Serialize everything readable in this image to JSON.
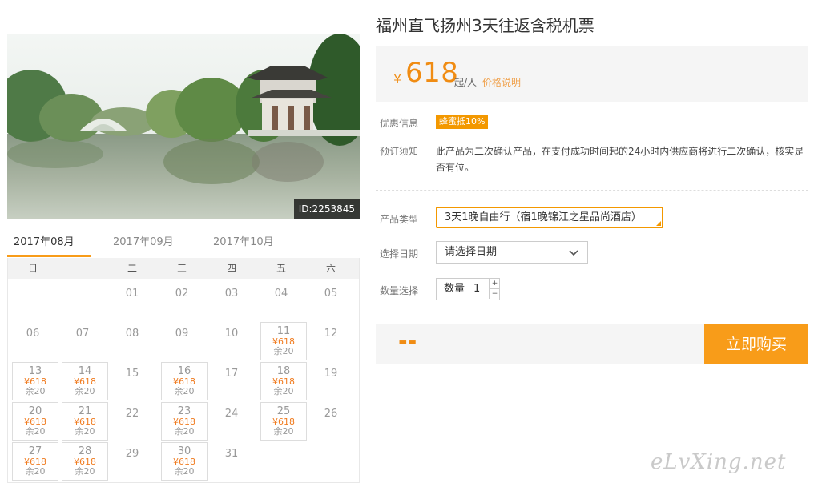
{
  "product": {
    "title": "福州直飞扬州3天往返含税机票",
    "image_id": "ID:2253845"
  },
  "price": {
    "currency": "¥",
    "amount": "618",
    "unit": "起/人",
    "note_link": "价格说明"
  },
  "promo": {
    "label": "优惠信息",
    "tag": "蜂蜜抵10%"
  },
  "notice": {
    "label": "预订须知",
    "text": "此产品为二次确认产品，在支付成功时间起的24小时内供应商将进行二次确认，核实是否有位。"
  },
  "options": {
    "type_label": "产品类型",
    "type_value": "3天1晚自由行（宿1晚锦江之星品尚酒店）",
    "date_label": "选择日期",
    "date_placeholder": "请选择日期",
    "qty_section_label": "数量选择",
    "qty_label": "数量",
    "qty_value": "1",
    "qty_up": "+",
    "qty_down": "−"
  },
  "buy": {
    "total": "--",
    "button": "立即购买"
  },
  "calendar": {
    "months": [
      "2017年08月",
      "2017年09月",
      "2017年10月"
    ],
    "active_month": 0,
    "weekdays": [
      "日",
      "一",
      "二",
      "三",
      "四",
      "五",
      "六"
    ],
    "first_weekday": 2,
    "days_in_month": 31,
    "available": [
      {
        "day": "11",
        "price": "¥618",
        "stock": "余20"
      },
      {
        "day": "13",
        "price": "¥618",
        "stock": "余20"
      },
      {
        "day": "14",
        "price": "¥618",
        "stock": "余20"
      },
      {
        "day": "16",
        "price": "¥618",
        "stock": "余20"
      },
      {
        "day": "18",
        "price": "¥618",
        "stock": "余20"
      },
      {
        "day": "20",
        "price": "¥618",
        "stock": "余20"
      },
      {
        "day": "21",
        "price": "¥618",
        "stock": "余20"
      },
      {
        "day": "23",
        "price": "¥618",
        "stock": "余20"
      },
      {
        "day": "25",
        "price": "¥618",
        "stock": "余20"
      },
      {
        "day": "27",
        "price": "¥618",
        "stock": "余20"
      },
      {
        "day": "28",
        "price": "¥618",
        "stock": "余20"
      },
      {
        "day": "30",
        "price": "¥618",
        "stock": "余20"
      }
    ]
  },
  "watermark": "eLvXing.net",
  "colors": {
    "accent": "#f39800",
    "price": "#f08c13",
    "button": "#f89c19"
  }
}
